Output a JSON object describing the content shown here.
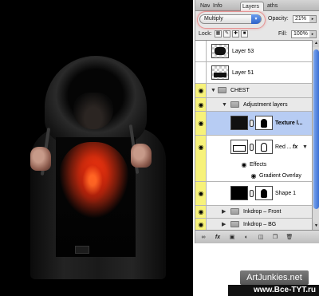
{
  "palette": {
    "tabs": [
      "Nav",
      "Info",
      "Layers",
      "aths"
    ],
    "active_tab": "Layers",
    "blend_mode": "Multiply",
    "opacity_label": "Opacity:",
    "opacity_value": "21%",
    "lock_label": "Lock:",
    "fill_label": "Fill:",
    "fill_value": "100%",
    "layers": [
      {
        "name": "Layer 53",
        "visible": false
      },
      {
        "name": "Layer 51",
        "visible": false
      },
      {
        "name": "CHEST",
        "type": "group",
        "visible": true
      },
      {
        "name": "Adjustment layers",
        "type": "group",
        "visible": true
      },
      {
        "name": "Texture l...",
        "selected": true,
        "visible": true
      },
      {
        "name": "Red ...",
        "visible": true,
        "fx": "fx"
      },
      {
        "name": "Effects",
        "type": "effects-header"
      },
      {
        "name": "Gradient Overlay",
        "type": "effect"
      },
      {
        "name": "Shape 1",
        "visible": true
      },
      {
        "name": "Inkdrop – Front",
        "type": "group",
        "visible": true
      },
      {
        "name": "Inkdrop – BG",
        "type": "group",
        "visible": true
      }
    ],
    "bottom_icons": [
      "link-icon",
      "fx-icon",
      "mask-icon",
      "adjustment-icon",
      "folder-icon",
      "new-layer-icon",
      "trash-icon"
    ]
  },
  "watermarks": {
    "primary": "ArtJunkies.net",
    "secondary": "www.Bce-TYT.ru"
  },
  "colors": {
    "selection": "#b7ccf3",
    "visibility_column": "#f7f27a",
    "blend_highlight": "#e65050"
  }
}
